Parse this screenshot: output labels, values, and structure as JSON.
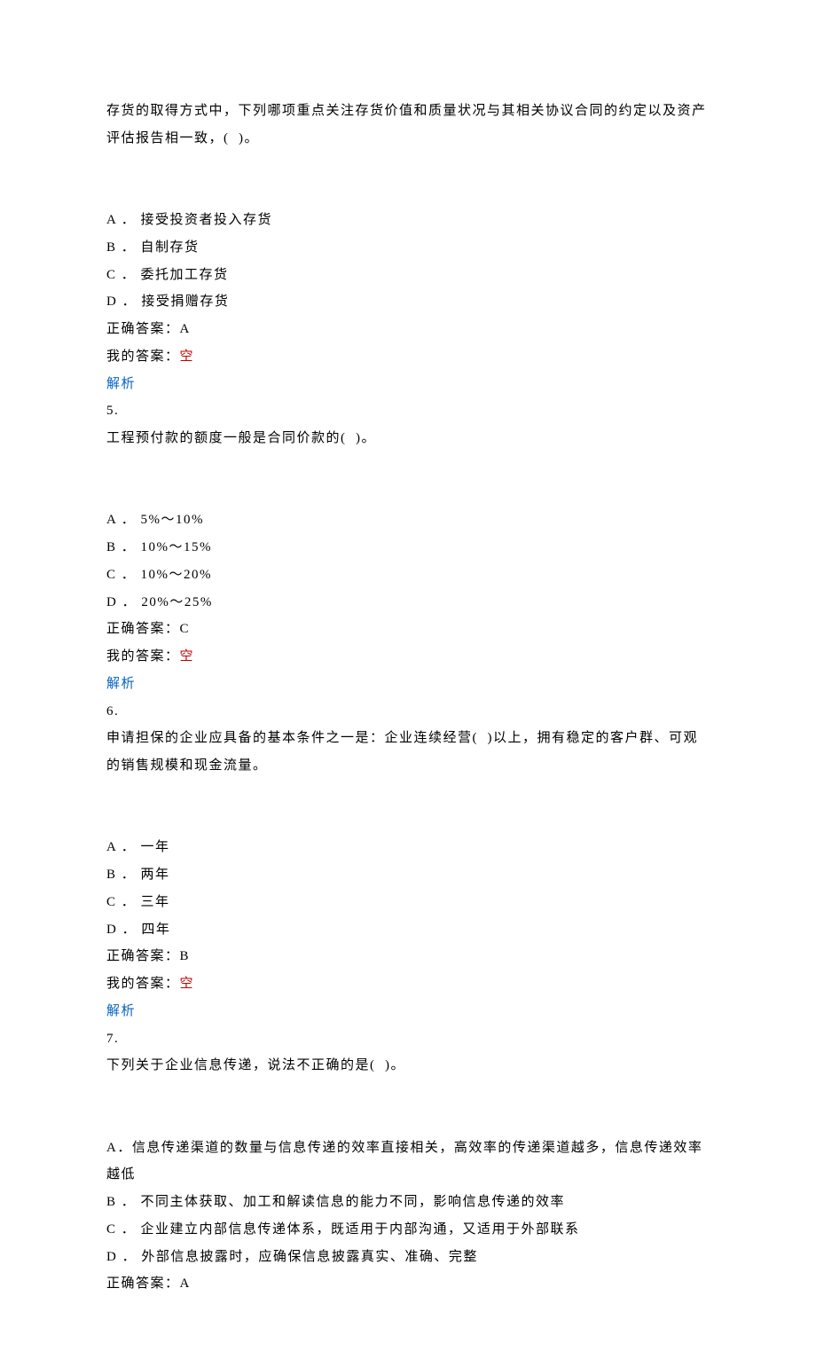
{
  "q4": {
    "stem": "存货的取得方式中，下列哪项重点关注存货价值和质量状况与其相关协议合同的约定以及资产评估报告相一致，(  )。",
    "optA": "A ． 接受投资者投入存货",
    "optB": "B ． 自制存货",
    "optC": "C ． 委托加工存货",
    "optD": "D ． 接受捐赠存货",
    "correct": "正确答案：A",
    "mine_label": "我的答案：",
    "mine_value": "空",
    "analysis": "解析"
  },
  "q5": {
    "num": "5.",
    "stem": "工程预付款的额度一般是合同价款的(  )。",
    "optA": "A ． 5%～10%",
    "optB": "B ． 10%～15%",
    "optC": "C ． 10%～20%",
    "optD": "D ． 20%～25%",
    "correct": "正确答案：C",
    "mine_label": "我的答案：",
    "mine_value": "空",
    "analysis": "解析"
  },
  "q6": {
    "num": "6.",
    "stem": "申请担保的企业应具备的基本条件之一是：企业连续经营(  )以上，拥有稳定的客户群、可观的销售规模和现金流量。",
    "optA": "A ． 一年",
    "optB": "B ． 两年",
    "optC": "C ． 三年",
    "optD": "D ． 四年",
    "correct": "正确答案：B",
    "mine_label": "我的答案：",
    "mine_value": "空",
    "analysis": "解析"
  },
  "q7": {
    "num": "7.",
    "stem": "下列关于企业信息传递，说法不正确的是(  )。",
    "optA": "A．信息传递渠道的数量与信息传递的效率直接相关，高效率的传递渠道越多，信息传递效率越低",
    "optB": "B ． 不同主体获取、加工和解读信息的能力不同，影响信息传递的效率",
    "optC": "C ． 企业建立内部信息传递体系，既适用于内部沟通，又适用于外部联系",
    "optD": "D ． 外部信息披露时，应确保信息披露真实、准确、完整",
    "correct": "正确答案：A"
  }
}
